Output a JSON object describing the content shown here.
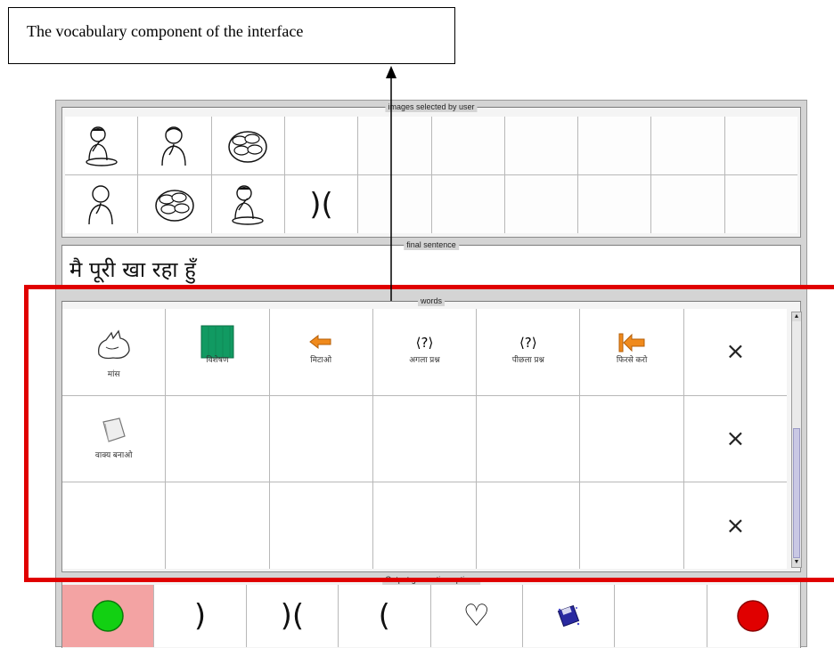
{
  "callout": {
    "text": "The vocabulary component of the interface"
  },
  "panels": {
    "images_selected": {
      "legend": "images selected by user"
    },
    "final_sentence": {
      "legend": "final sentence",
      "text": "मै पूरी खा रहा हुँ"
    },
    "words": {
      "legend": "words"
    },
    "output": {
      "legend": "Output generation options"
    }
  },
  "images_selected": {
    "row1": [
      "boy-eating",
      "boy-thinking",
      "puri-plate",
      "",
      "",
      "",
      "",
      "",
      "",
      ""
    ],
    "row2": [
      "boy-thinking",
      "puri-plate",
      "boy-eating",
      ")(",
      "",
      "",
      "",
      "",
      "",
      ""
    ]
  },
  "words": {
    "row1": [
      {
        "label": "मांस",
        "icon": "meat-icon"
      },
      {
        "label": "विशेषण",
        "icon": "green-square-icon"
      },
      {
        "label": "मिटाओ",
        "icon": "undo-arrow-icon"
      },
      {
        "label": "अगला प्रश्न",
        "icon": "next-question-icon",
        "glyph": "⟨?⟩"
      },
      {
        "label": "पीछला प्रश्न",
        "icon": "previous-question-icon",
        "glyph": "⟨?⟩"
      },
      {
        "label": "फिरसे करो",
        "icon": "restart-icon"
      }
    ],
    "row2": [
      {
        "label": "वाक्य बनाओ",
        "icon": "paper-icon"
      }
    ],
    "close_glyph": "×"
  },
  "output": {
    "glyphs": [
      "",
      ")",
      ")(",
      "(",
      "♡",
      "",
      "",
      ""
    ],
    "colors": {
      "go": "#12d012",
      "stop": "#e00000",
      "active_bg": "#f3a3a3"
    }
  }
}
